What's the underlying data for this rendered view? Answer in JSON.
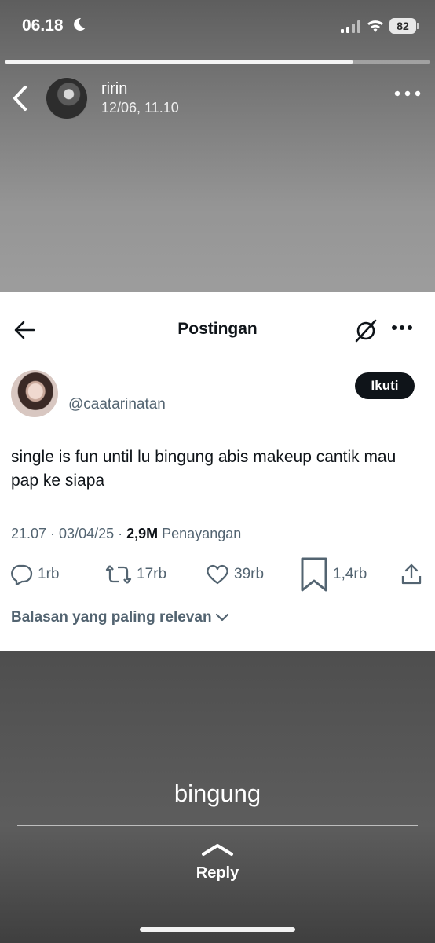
{
  "status_bar": {
    "time": "06.18",
    "battery": "82"
  },
  "story": {
    "progress_fraction": 0.82,
    "user_name": "ririn",
    "posted_at": "12/06, 11.10"
  },
  "post": {
    "page_title": "Postingan",
    "author_handle": "@caatarinatan",
    "follow_label": "Ikuti",
    "text": "single is fun until lu bingung abis makeup cantik mau pap ke siapa",
    "meta_time": "21.07 · 03/04/25 · ",
    "views_count": "2,9M",
    "views_label": " Penayangan",
    "actions": {
      "replies": "1rb",
      "reposts": "17rb",
      "likes": "39rb",
      "bookmarks": "1,4rb"
    },
    "sort_label": "Balasan yang paling relevan"
  },
  "caption": "bingung",
  "reply_label": "Reply",
  "colors": {
    "text_primary": "#0f1419",
    "text_secondary": "#536471",
    "card_bg": "#ffffff"
  }
}
